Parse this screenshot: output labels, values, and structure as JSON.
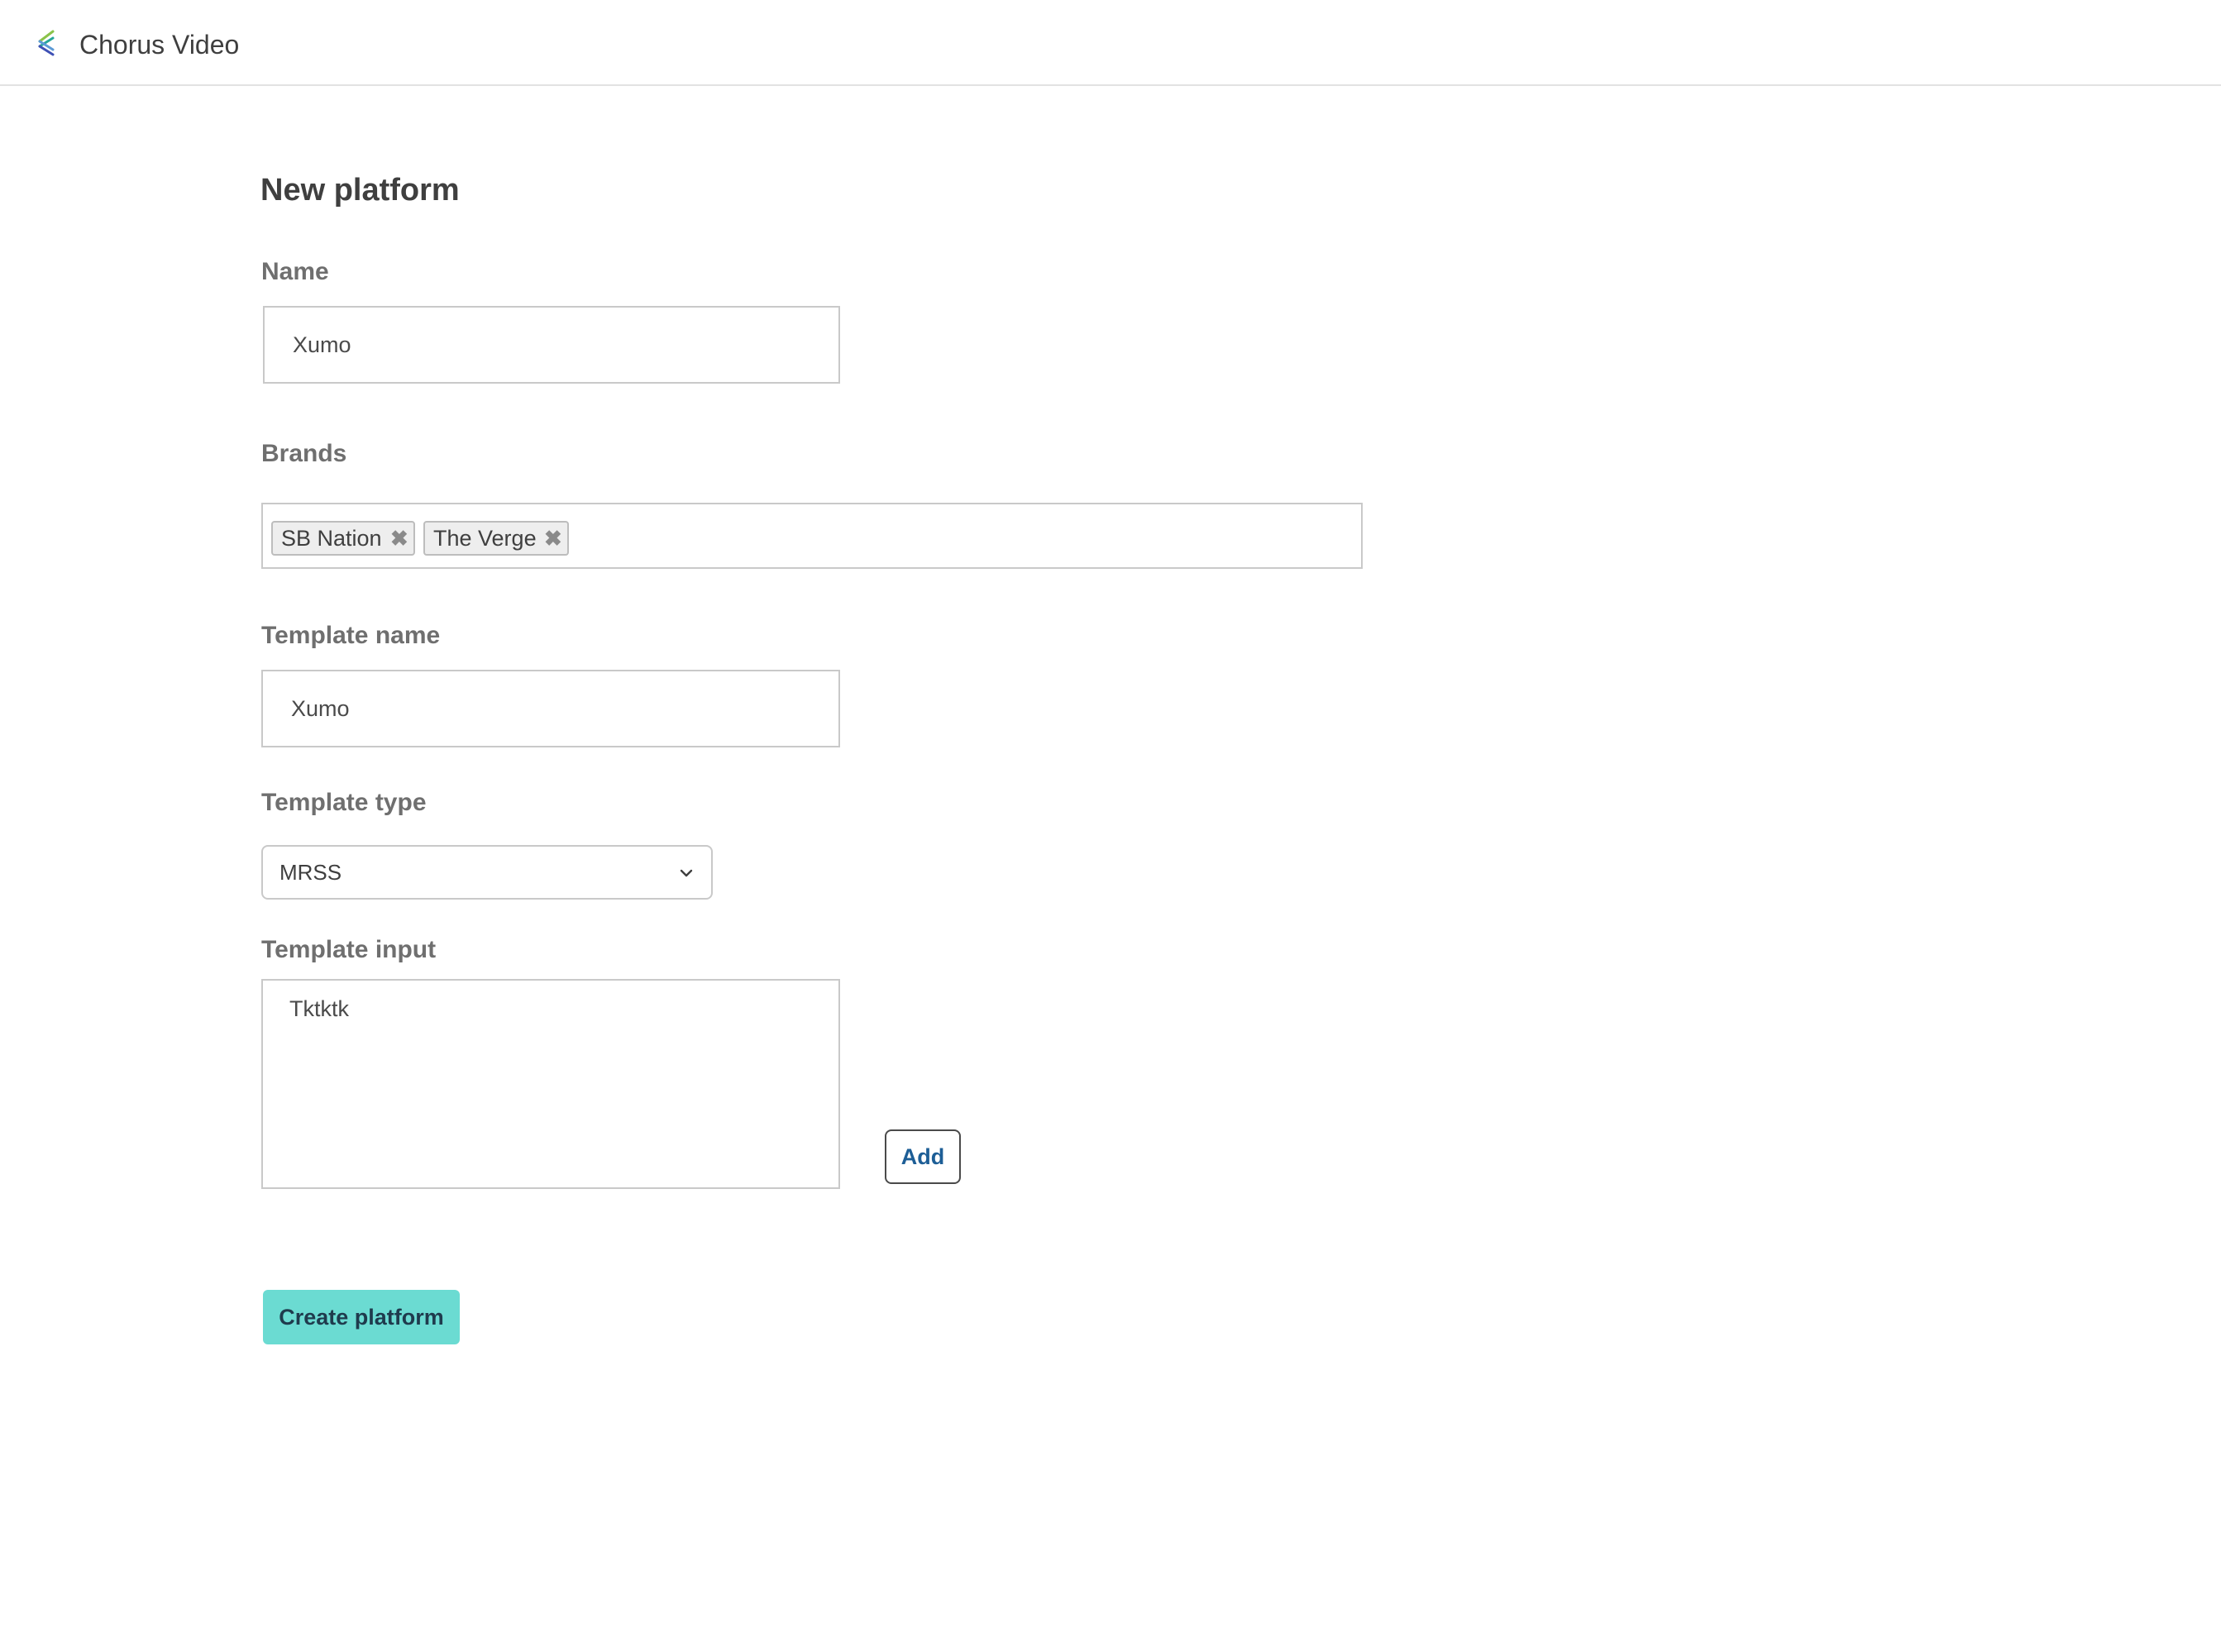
{
  "app": {
    "title": "Chorus Video",
    "logo_icon": "chorus-logo-icon"
  },
  "page": {
    "title": "New platform"
  },
  "form": {
    "name": {
      "label": "Name",
      "value": "Xumo"
    },
    "brands": {
      "label": "Brands",
      "tags": [
        {
          "label": "SB Nation",
          "remove_icon": "close-icon"
        },
        {
          "label": "The Verge",
          "remove_icon": "close-icon"
        }
      ]
    },
    "template_name": {
      "label": "Template name",
      "value": "Xumo"
    },
    "template_type": {
      "label": "Template type",
      "selected": "MRSS",
      "icon": "chevron-down-icon"
    },
    "template_input": {
      "label": "Template input",
      "value": "Tktktk"
    },
    "add_button": "Add",
    "submit_button": "Create platform"
  },
  "colors": {
    "accent": "#6bdbd2",
    "link": "#1d5e96",
    "border": "#c9c9c9"
  }
}
